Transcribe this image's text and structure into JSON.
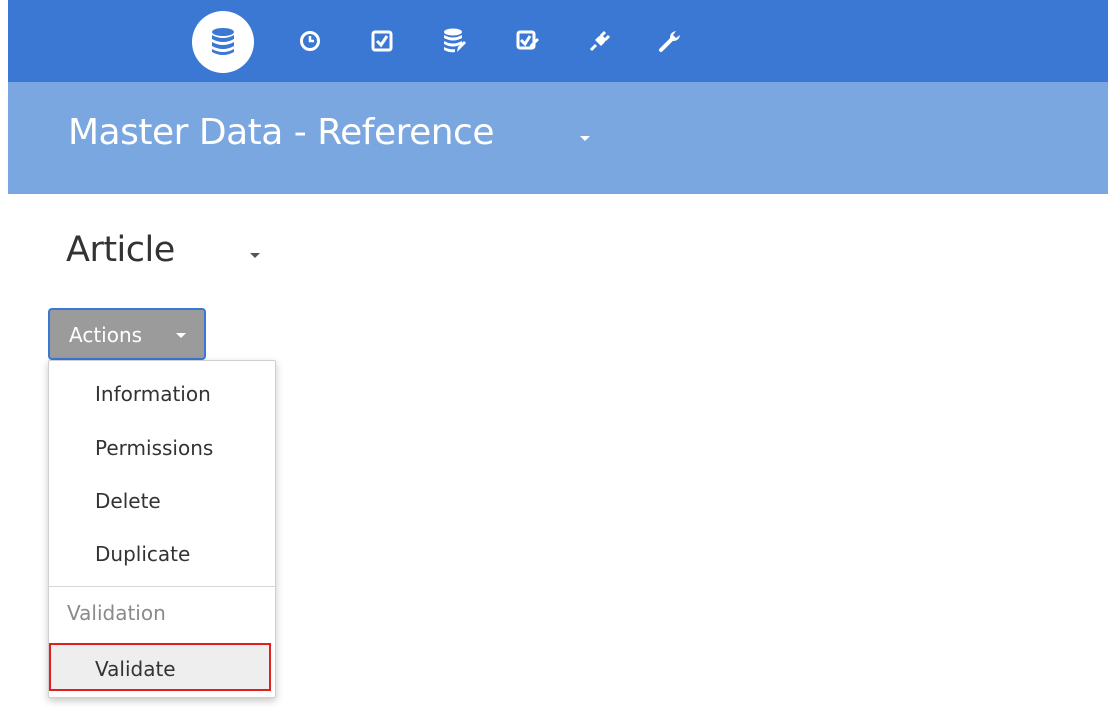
{
  "nav": {
    "icons": [
      "database-icon",
      "clock-icon",
      "checkbox-icon",
      "database-edit-icon",
      "checkbox-edit-icon",
      "plug-icon",
      "wrench-icon"
    ],
    "active": "database-icon"
  },
  "header": {
    "title": "Master Data - Reference"
  },
  "entity": {
    "title": "Article"
  },
  "actions": {
    "label": "Actions",
    "menu": {
      "items": [
        "Information",
        "Permissions",
        "Delete",
        "Duplicate"
      ],
      "section_header": "Validation",
      "validate_label": "Validate"
    }
  },
  "colors": {
    "topbar": "#3a78d4",
    "titlebar": "#7ba7e0",
    "button": "#9b9b9b",
    "highlight_border": "#e0201e"
  }
}
